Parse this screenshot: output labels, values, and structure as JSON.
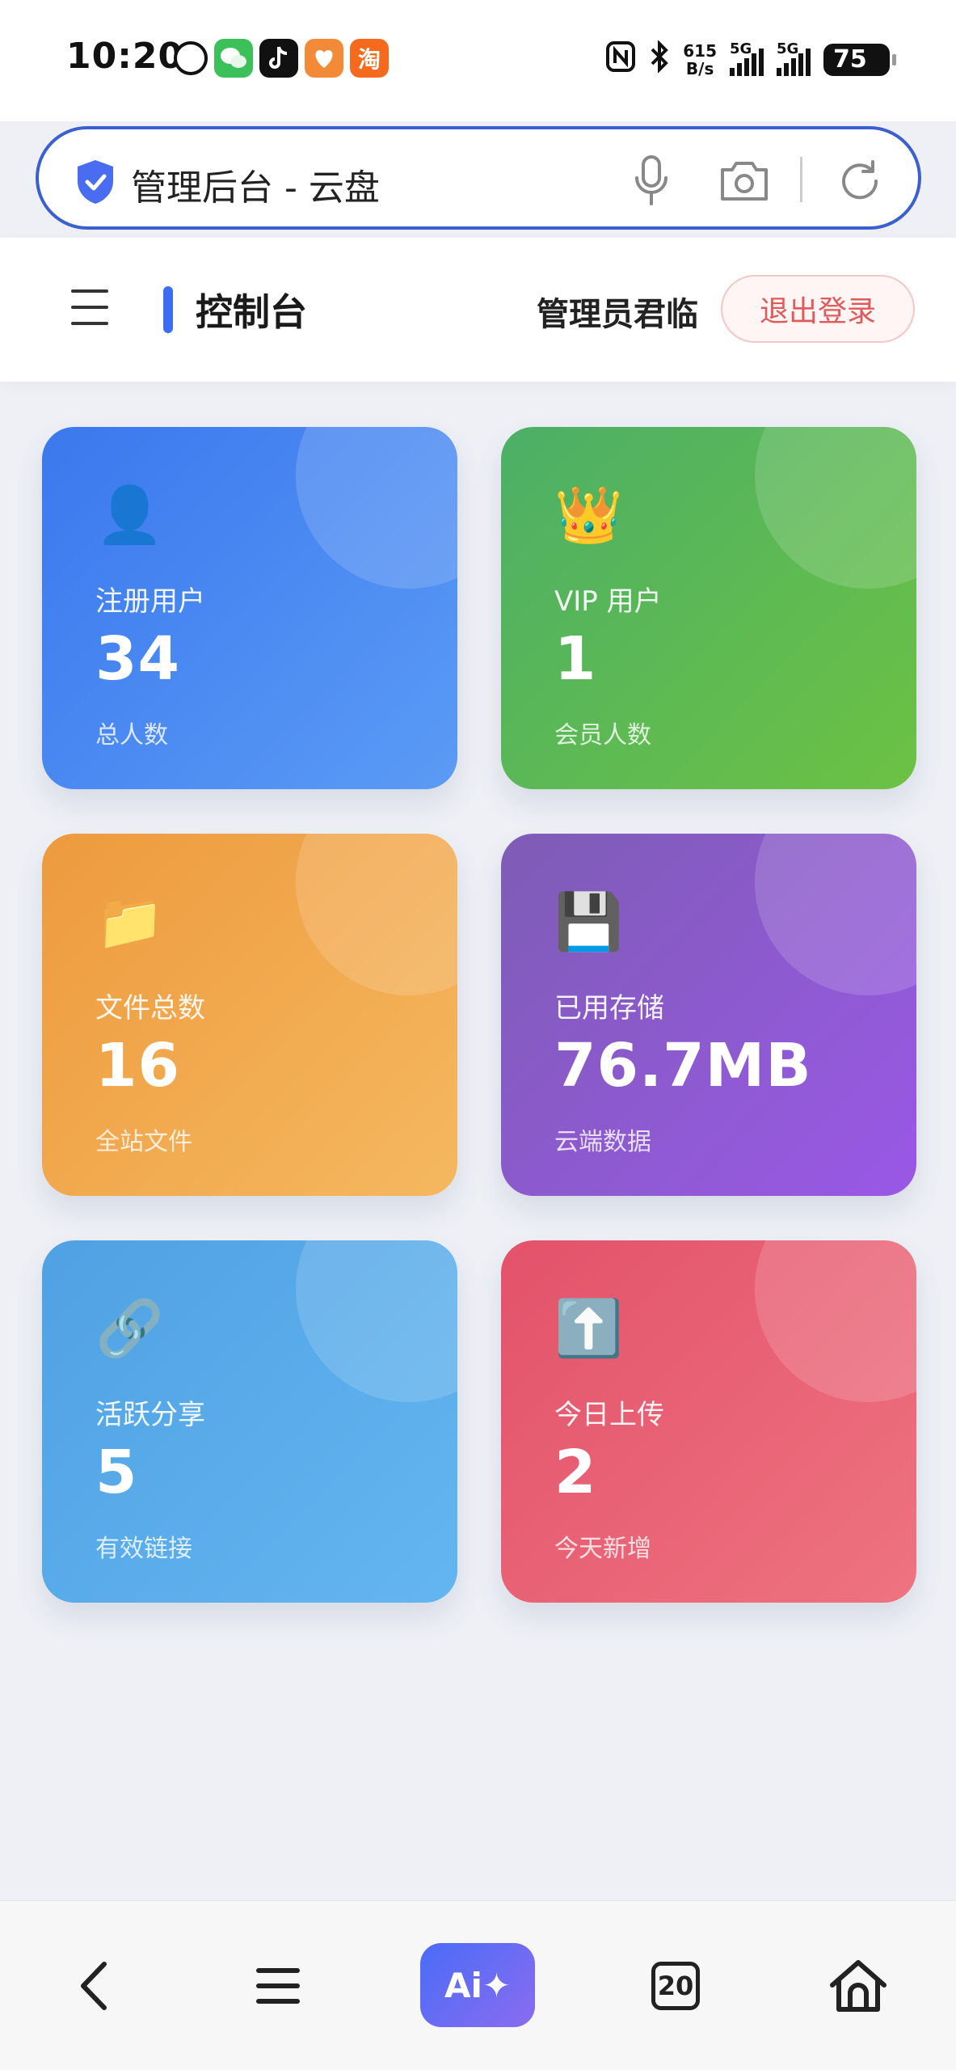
{
  "status": {
    "time": "10:20",
    "net_speed_top": "615",
    "net_speed_unit": "B/s",
    "sig1": "5G",
    "sig2": "5G",
    "battery": "75",
    "taobao_glyph": "淘"
  },
  "browser": {
    "url_title": "管理后台 - 云盘",
    "tab_count": "20",
    "ai_label": "Ai✦"
  },
  "header": {
    "title": "控制台",
    "admin_name": "管理员君临",
    "logout_label": "退出登录"
  },
  "cards": [
    {
      "icon": "👤",
      "label": "注册用户",
      "value": "34",
      "sub": "总人数"
    },
    {
      "icon": "👑",
      "label": "VIP 用户",
      "value": "1",
      "sub": "会员人数"
    },
    {
      "icon": "📁",
      "label": "文件总数",
      "value": "16",
      "sub": "全站文件"
    },
    {
      "icon": "💾",
      "label": "已用存储",
      "value": "76.7MB",
      "sub": "云端数据"
    },
    {
      "icon": "🔗",
      "label": "活跃分享",
      "value": "5",
      "sub": "有效链接"
    },
    {
      "icon": "⬆️",
      "label": "今日上传",
      "value": "2",
      "sub": "今天新增"
    }
  ],
  "colors": {
    "accent": "#3b6ef5",
    "card_blue": "#3a78ee",
    "card_green": "#4caf67",
    "card_orange": "#ee9a3e",
    "card_purple": "#8a5cd8",
    "card_sky": "#4fa1e3",
    "card_red": "#e3526a",
    "logout_text": "#e05a5a"
  }
}
